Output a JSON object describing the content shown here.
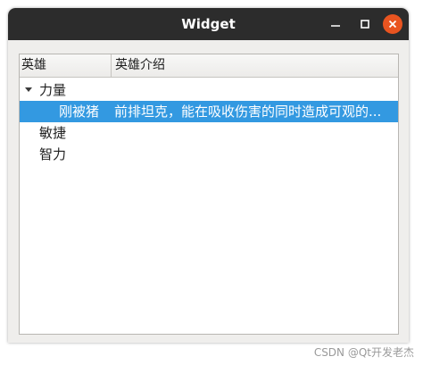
{
  "window": {
    "title": "Widget",
    "close_color": "#e95420",
    "titlebar_color": "#2c2c2c"
  },
  "tree": {
    "headers": [
      "英雄",
      "英雄介绍"
    ],
    "selection_color": "#3399e1",
    "rows": [
      {
        "name": "力量",
        "desc": "",
        "expanded": true,
        "level": 0,
        "selected": false
      },
      {
        "name": "刚被猪",
        "desc": "前排坦克，能在吸收伤害的同时造成可观的...",
        "level": 1,
        "selected": true
      },
      {
        "name": "敏捷",
        "desc": "",
        "level": 0,
        "selected": false
      },
      {
        "name": "智力",
        "desc": "",
        "level": 0,
        "selected": false
      }
    ]
  },
  "icons": {
    "minimize": "minimize-icon",
    "maximize": "maximize-icon",
    "close": "close-icon",
    "expand": "expand-arrow-icon"
  },
  "watermark": "CSDN @Qt开发老杰"
}
